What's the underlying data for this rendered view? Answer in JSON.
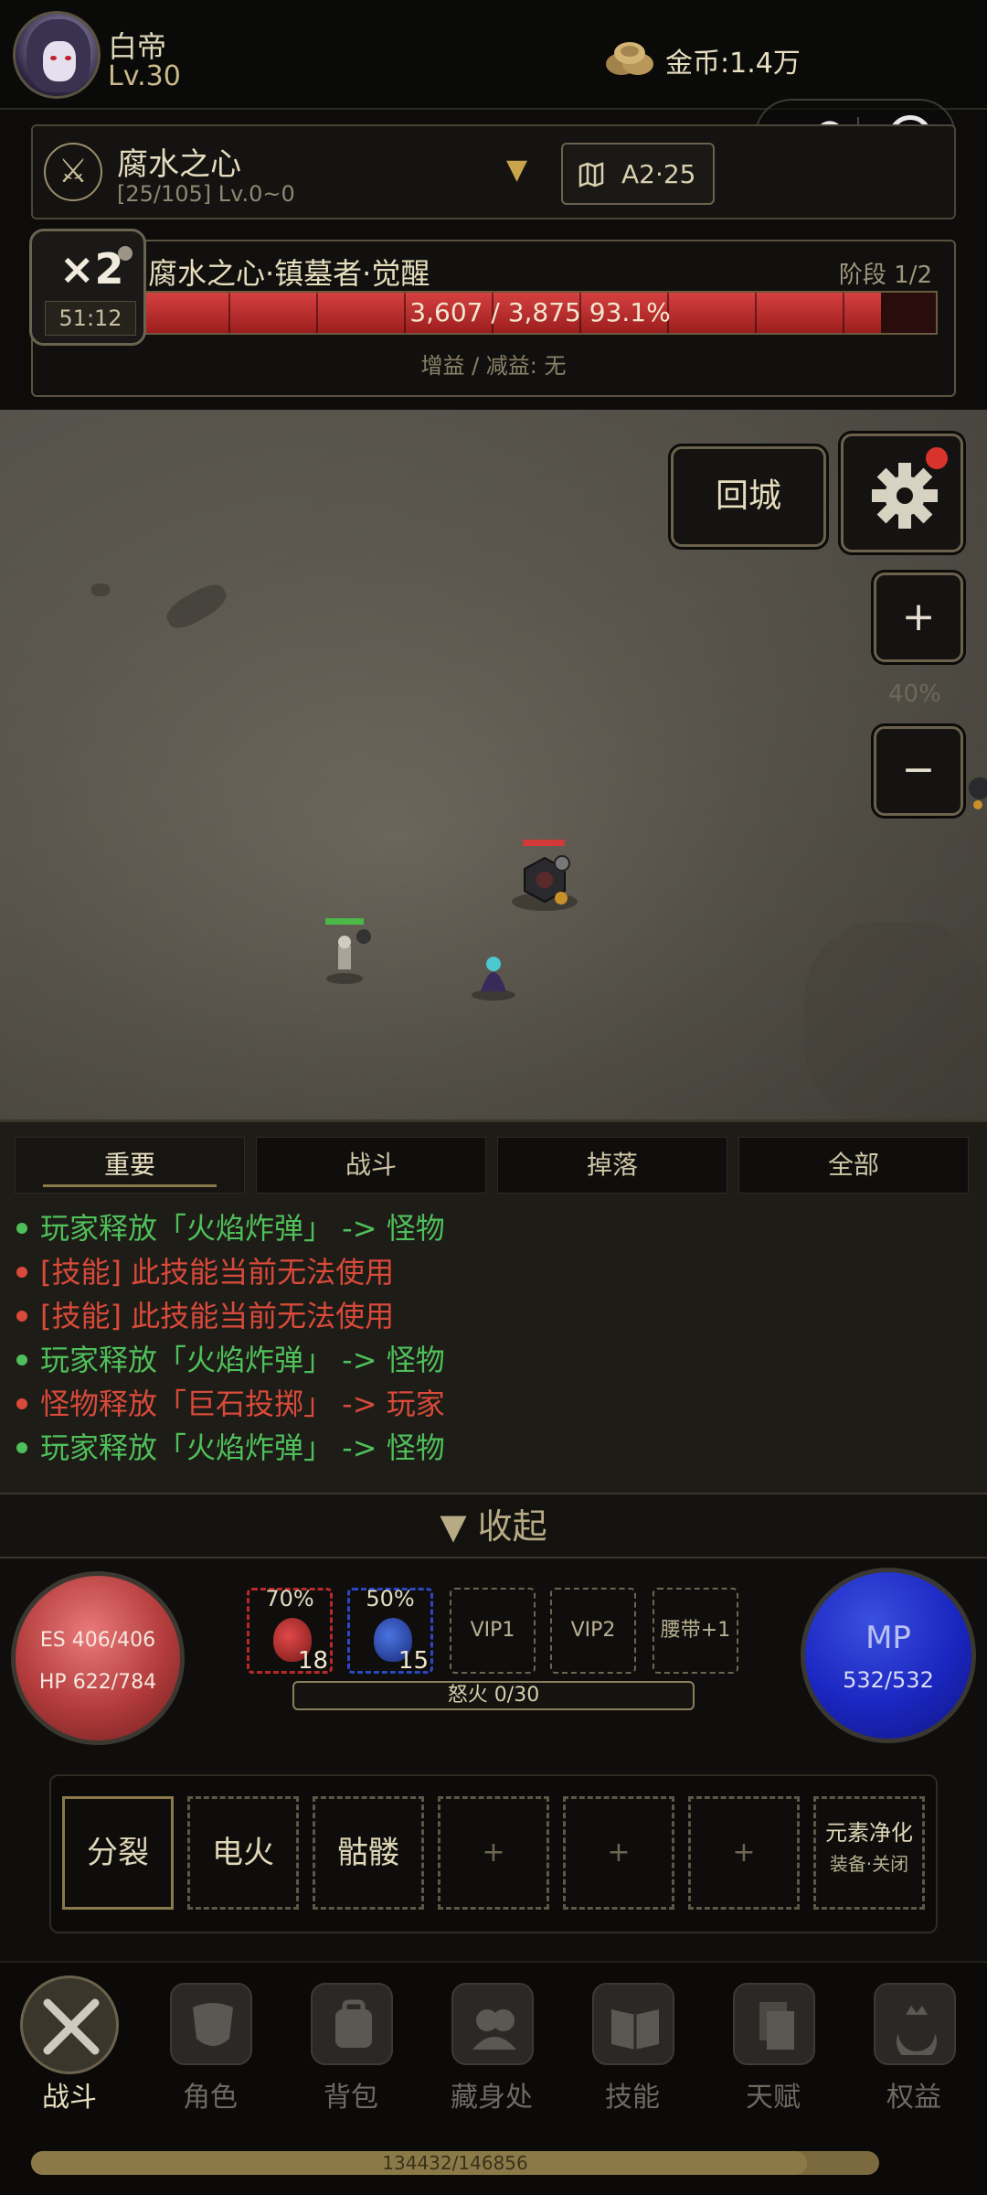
{
  "header": {
    "player_name": "白帝",
    "level": "Lv.30",
    "gold": "金币:1.4万",
    "menu_icon": "more-dots-icon",
    "close_icon": "target-icon"
  },
  "zone": {
    "name": "腐水之心",
    "sub": "[25/105] Lv.0~0",
    "map_label": "A2·25"
  },
  "boss": {
    "name": "腐水之心·镇墓者·觉醒",
    "stage": "阶段 1/2",
    "hp_text": "3,607 / 3,875   93.1%",
    "hp_fraction": 0.931,
    "buffs": "增益 / 减益: 无",
    "multiplier": "×2",
    "timer": "51:12"
  },
  "map": {
    "town_button": "回城",
    "zoom_in": "+",
    "zoom_out": "−",
    "zoom_level": "40%",
    "player_hp_fraction": 1.0,
    "enemy_hp_fraction": 1.0
  },
  "log": {
    "tabs": [
      "重要",
      "战斗",
      "掉落",
      "全部"
    ],
    "active_tab": 0,
    "lines": [
      {
        "text": "玩家释放「火焰炸弹」 -> 怪物",
        "type": "g"
      },
      {
        "text": "[技能] 此技能当前无法使用",
        "type": "r"
      },
      {
        "text": "[技能] 此技能当前无法使用",
        "type": "r"
      },
      {
        "text": "玩家释放「火焰炸弹」 -> 怪物",
        "type": "g"
      },
      {
        "text": "怪物释放「巨石投掷」 -> 玩家",
        "type": "r"
      },
      {
        "text": "玩家释放「火焰炸弹」 -> 怪物",
        "type": "g"
      }
    ],
    "collapse": "▼ 收起"
  },
  "status": {
    "es": "ES 406/406",
    "hp": "HP 622/784",
    "mp_label": "MP",
    "mp": "532/532",
    "hp_potion_pct": "70%",
    "hp_potion_count": "18",
    "mp_potion_pct": "50%",
    "mp_potion_count": "15",
    "vip1": "VIP1",
    "vip2": "VIP2",
    "belt": "腰带+1",
    "rage": "怒火 0/30"
  },
  "skills": {
    "s1": "分裂",
    "s2": "电火",
    "s3": "骷髅",
    "empty": "+",
    "toggle_line1": "元素净化",
    "toggle_line2": "装备·关闭"
  },
  "nav": {
    "items": [
      "战斗",
      "角色",
      "背包",
      "藏身处",
      "技能",
      "天赋",
      "权益"
    ],
    "active": 0
  },
  "xp": {
    "text": "134432/146856",
    "fraction": 0.915
  },
  "colors": {
    "good_log": "#4fbf5a",
    "bad_log": "#d84a3a",
    "boss_bar": "#c23030",
    "hp_orb": "#b23b3b",
    "mp_orb": "#1a26c0",
    "gold_accent": "#c9a44a"
  }
}
